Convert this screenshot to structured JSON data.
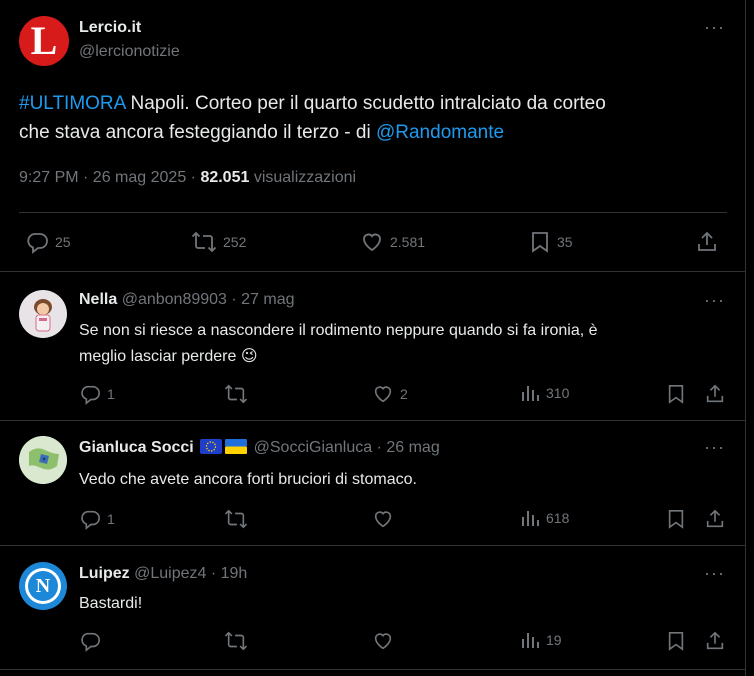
{
  "main_post": {
    "author_name": "Lercio.it",
    "handle": "@lercionotizie",
    "logo_letter": "L",
    "hashtag": "#ULTIMORA",
    "text_line1": " Napoli. Corteo per il quarto scudetto intralciato da corteo",
    "text_line2": "che stava ancora festeggiando il terzo - di ",
    "mention": "@Randomante",
    "time": "9:27 PM · 26 mag 2025 · ",
    "views": "82.051",
    "views_label": " visualizzazioni",
    "replies": "25",
    "reposts": "252",
    "likes": "2.581",
    "bookmarks": "35"
  },
  "replies": [
    {
      "name": "Nella",
      "handle": "@anbon89903 · 27 mag",
      "text_line1": "Se non si riesce a nascondere il rodimento neppure quando si fa ironia, è",
      "text_line2": "meglio lasciar perdere",
      "emoji": "😉",
      "replies": "1",
      "reposts": "",
      "likes": "2",
      "views": "310"
    },
    {
      "name": "Gianluca Socci",
      "flags": "🇪🇺🇺🇦",
      "handle": "@SocciGianluca · 26 mag",
      "text_line1": "Vedo che avete ancora forti bruciori di stomaco.",
      "replies": "1",
      "reposts": "",
      "likes": "",
      "views": "618"
    },
    {
      "name": "Luipez",
      "handle": "@Luipez4 · 19h",
      "text_line1": "Bastardi!",
      "avatar_letter": "N",
      "replies": "",
      "reposts": "",
      "likes": "",
      "views": "19"
    }
  ],
  "colors": {
    "background": "#000000",
    "text": "#e7e9ea",
    "muted": "#71767b",
    "link": "#1d9bf0",
    "lercio_red": "#d71a1a",
    "divider": "#2f3336",
    "napoli_blue": "#1e88d8"
  },
  "icons": [
    "more-icon",
    "reply-icon",
    "repost-icon",
    "like-icon",
    "bookmark-icon",
    "share-icon",
    "views-icon"
  ]
}
